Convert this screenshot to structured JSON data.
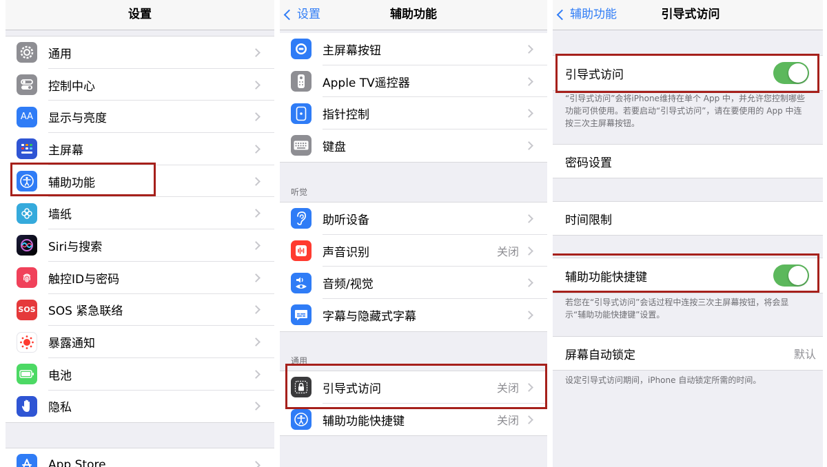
{
  "panel1": {
    "title": "设置",
    "items": [
      {
        "label": "通用",
        "icon": "gear-icon"
      },
      {
        "label": "控制中心",
        "icon": "control-center-icon"
      },
      {
        "label": "显示与亮度",
        "icon": "display-brightness-icon",
        "icon_text": "AA"
      },
      {
        "label": "主屏幕",
        "icon": "home-screen-icon"
      },
      {
        "label": "辅助功能",
        "icon": "accessibility-icon"
      },
      {
        "label": "墙纸",
        "icon": "wallpaper-icon"
      },
      {
        "label": "Siri与搜索",
        "icon": "siri-icon"
      },
      {
        "label": "触控ID与密码",
        "icon": "fingerprint-icon"
      },
      {
        "label": "SOS 紧急联络",
        "icon": "sos-icon",
        "icon_text": "SOS"
      },
      {
        "label": "暴露通知",
        "icon": "exposure-notification-icon"
      },
      {
        "label": "电池",
        "icon": "battery-icon"
      },
      {
        "label": "隐私",
        "icon": "privacy-hand-icon"
      }
    ],
    "partial_item": {
      "label": "App Store",
      "icon": "app-store-icon"
    }
  },
  "panel2": {
    "back_label": "设置",
    "title": "辅助功能",
    "group1": [
      {
        "label": "主屏幕按钮",
        "icon": "home-button-icon"
      },
      {
        "label": "Apple TV遥控器",
        "icon": "tv-remote-icon"
      },
      {
        "label": "指针控制",
        "icon": "pointer-control-icon"
      },
      {
        "label": "键盘",
        "icon": "keyboard-icon"
      }
    ],
    "hearing_header": "听觉",
    "hearing": [
      {
        "label": "助听设备",
        "icon": "ear-icon",
        "value": ""
      },
      {
        "label": "声音识别",
        "icon": "sound-recognition-icon",
        "value": "关闭"
      },
      {
        "label": "音频/视觉",
        "icon": "audio-visual-icon",
        "value": ""
      },
      {
        "label": "字幕与隐藏式字幕",
        "icon": "subtitles-icon",
        "value": ""
      }
    ],
    "general_header": "通用",
    "general": [
      {
        "label": "引导式访问",
        "icon": "guided-access-icon",
        "value": "关闭"
      },
      {
        "label": "辅助功能快捷键",
        "icon": "accessibility-icon",
        "value": "关闭"
      }
    ]
  },
  "panel3": {
    "back_label": "辅助功能",
    "title": "引导式访问",
    "guided_access": {
      "label": "引导式访问",
      "on": true
    },
    "guided_access_footer": "“引导式访问”会将iPhone维持在单个 App 中，并允许您控制哪些功能可供使用。若要启动“引导式访问”，请在要使用的 App 中连按三次主屏幕按钮。",
    "passcode": {
      "label": "密码设置"
    },
    "time_limit": {
      "label": "时间限制"
    },
    "shortcut": {
      "label": "辅助功能快捷键",
      "on": true
    },
    "shortcut_footer": "若您在“引导式访问”会话过程中连按三次主屏幕按钮，将会显示“辅助功能快捷键”设置。",
    "autolock": {
      "label": "屏幕自动锁定",
      "value": "默认"
    },
    "autolock_footer": "设定引导式访问期间，iPhone 自动锁定所需的时间。"
  },
  "colors": {
    "highlight": "#a6201b",
    "toggle_on": "#5cb85c",
    "link_blue": "#2f7cf6"
  }
}
